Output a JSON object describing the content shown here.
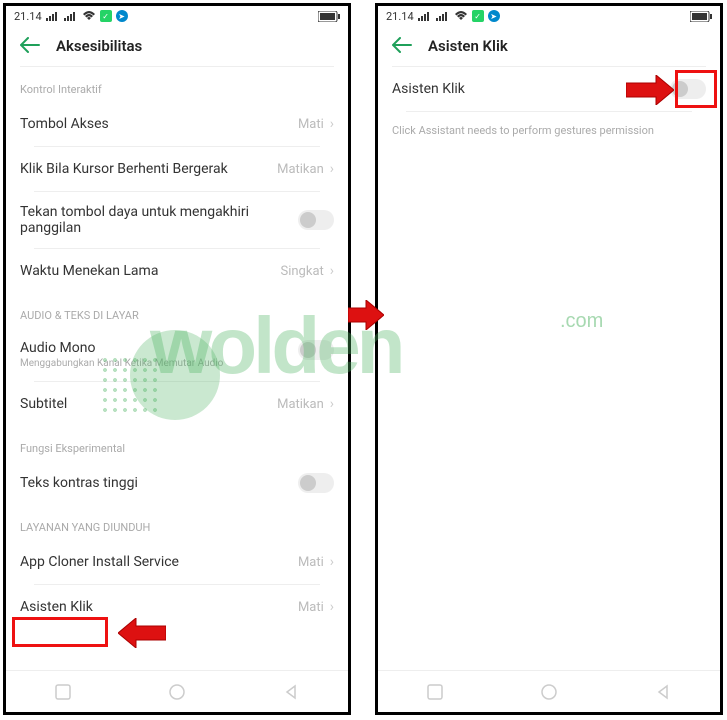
{
  "status": {
    "time": "21.14",
    "battery_icon": "battery"
  },
  "left_screen": {
    "header_title": "Aksesibilitas",
    "sections": {
      "kontrol": {
        "label": "Kontrol Interaktif",
        "items": {
          "tombol_akses": {
            "label": "Tombol Akses",
            "value": "Mati"
          },
          "klik_kursor": {
            "label": "Klik Bila Kursor Berhenti Bergerak",
            "value": "Matikan"
          },
          "tekan_tombol": {
            "label": "Tekan tombol daya untuk mengakhiri panggilan"
          },
          "waktu_menekan": {
            "label": "Waktu Menekan Lama",
            "value": "Singkat"
          }
        }
      },
      "audio": {
        "label": "AUDIO & TEKS DI LAYAR",
        "items": {
          "audio_mono": {
            "label": "Audio Mono",
            "sub": "Menggabungkan Kanal Ketika Memutar Audio"
          },
          "subtitel": {
            "label": "Subtitel",
            "value": "Matikan"
          }
        }
      },
      "fungsi": {
        "label": "Fungsi Eksperimental",
        "items": {
          "teks_kontras": {
            "label": "Teks kontras tinggi"
          }
        }
      },
      "layanan": {
        "label": "LAYANAN YANG DIUNDUH",
        "items": {
          "app_cloner": {
            "label": "App Cloner Install Service",
            "value": "Mati"
          },
          "asisten_klik": {
            "label": "Asisten Klik",
            "value": "Mati"
          }
        }
      }
    }
  },
  "right_screen": {
    "header_title": "Asisten Klik",
    "toggle_label": "Asisten Klik",
    "description": "Click Assistant needs to perform gestures permission"
  },
  "watermark": {
    "text": "wolden",
    "suffix": ".com"
  }
}
